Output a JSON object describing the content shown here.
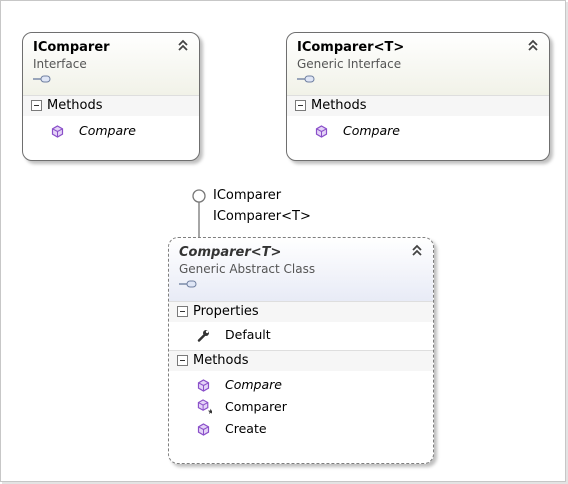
{
  "shapes": {
    "icomparer": {
      "name": "IComparer",
      "kind": "Interface",
      "sections": [
        {
          "label": "Methods",
          "members": [
            {
              "name": "Compare",
              "icon": "method-icon",
              "italic": true
            }
          ]
        }
      ]
    },
    "icomparer_t": {
      "name": "IComparer",
      "type_param": "<T>",
      "kind": "Generic Interface",
      "sections": [
        {
          "label": "Methods",
          "members": [
            {
              "name": "Compare",
              "icon": "method-icon",
              "italic": true
            }
          ]
        }
      ]
    },
    "comparer_t": {
      "name": "Comparer",
      "type_param": "<T>",
      "kind": "Generic Abstract Class",
      "sections": [
        {
          "label": "Properties",
          "members": [
            {
              "name": "Default",
              "icon": "property-wrench-icon",
              "italic": false
            }
          ]
        },
        {
          "label": "Methods",
          "members": [
            {
              "name": "Compare",
              "icon": "method-icon",
              "italic": true
            },
            {
              "name": "Comparer",
              "icon": "constructor-icon",
              "italic": false
            },
            {
              "name": "Create",
              "icon": "method-icon",
              "italic": false
            }
          ]
        }
      ]
    }
  },
  "lollipop": {
    "labels": [
      "IComparer",
      "IComparer<T>"
    ]
  },
  "colors": {
    "method_icon": "#8a4fc9",
    "interface_header": "#f1f2e8",
    "class_header": "#e8ebf6"
  }
}
